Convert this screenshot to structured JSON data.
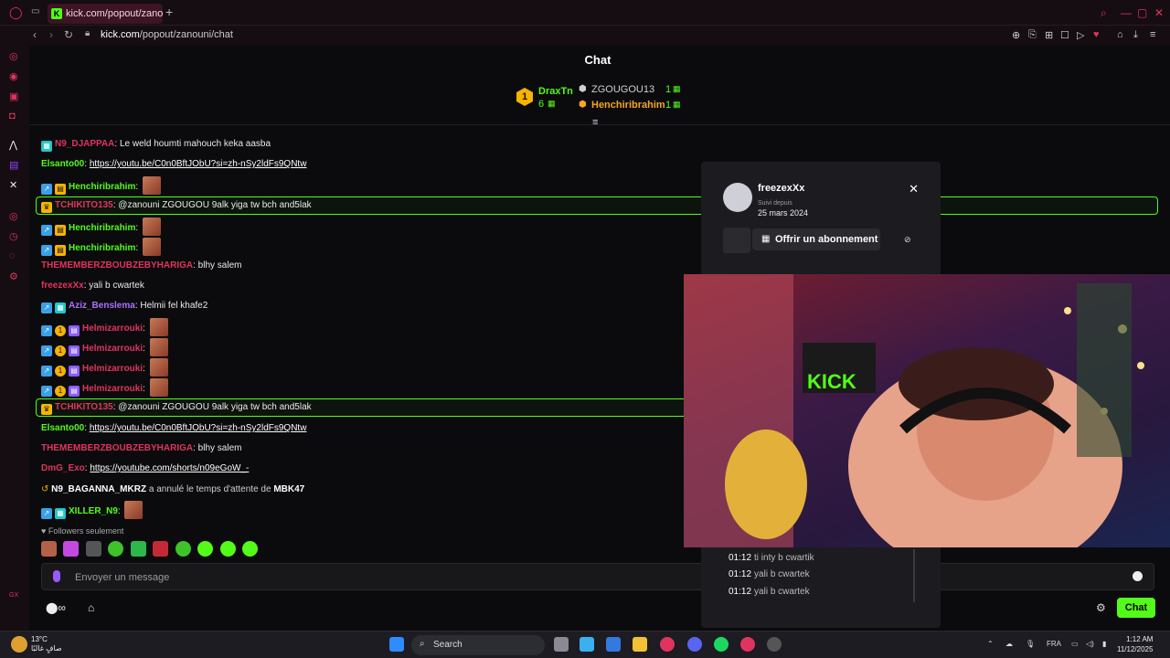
{
  "browser": {
    "tab_title": "kick.com/popout/zanouni",
    "new_tab": "+",
    "url_host": "kick.com",
    "url_path": "/popout/zanouni/chat"
  },
  "chat": {
    "title": "Chat",
    "leaderboard": [
      {
        "name": "DraxTn",
        "count": "6",
        "rank": "1",
        "color": "#53fc18"
      },
      {
        "name": "ZGOUGOU13",
        "count": "1",
        "color": "#cfcfcf"
      },
      {
        "name": "Henchiribrahim",
        "count": "1",
        "color": "#f5a623"
      }
    ],
    "messages": [
      {
        "user": "N9_DJAPPAA",
        "user_color": "#e0345f",
        "text": ": Le weld houmti mahouch keka aasba"
      },
      {
        "user": "Elsanto00",
        "user_color": "#53fc18",
        "text": ": ",
        "link": "https://youtu.be/C0n0BftJObU?si=zh-nSy2ldFs9QNtw"
      },
      {
        "user": "Henchiribrahim",
        "user_color": "#53fc18",
        "text": ": "
      },
      {
        "user": "TCHIKITO135",
        "user_color": "#e0345f",
        "text": ": @zanouni ZGOUGOU 9alk yiga tw bch and5lak"
      },
      {
        "user": "Henchiribrahim",
        "user_color": "#53fc18",
        "text": ": "
      },
      {
        "user": "Henchiribrahim",
        "user_color": "#53fc18",
        "text": ": "
      },
      {
        "user": "THEMEMBERZBOUBZEBYHARIGA",
        "user_color": "#e0345f",
        "text": ": blhy salem"
      },
      {
        "user": "freezexXx",
        "user_color": "#e0345f",
        "text": ": yali b cwartek"
      },
      {
        "user": "Aziz_Benslema",
        "user_color": "#a970ff",
        "text": ": Helmii fel khafe2"
      },
      {
        "user": "Helmizarrouki",
        "user_color": "#e0345f",
        "text": ": "
      },
      {
        "user": "Helmizarrouki",
        "user_color": "#e0345f",
        "text": ": "
      },
      {
        "user": "Helmizarrouki",
        "user_color": "#e0345f",
        "text": ": "
      },
      {
        "user": "Helmizarrouki",
        "user_color": "#e0345f",
        "text": ": "
      },
      {
        "user": "TCHIKITO135",
        "user_color": "#e0345f",
        "text": ": @zanouni ZGOUGOU 9alk yiga tw bch and5lak"
      },
      {
        "user": "Elsanto00",
        "user_color": "#53fc18",
        "text": ": ",
        "link": "https://youtu.be/C0n0BftJObU?si=zh-nSy2ldFs9QNtw"
      },
      {
        "user": "THEMEMBERZBOUBZEBYHARIGA",
        "user_color": "#e0345f",
        "text": ": blhy salem"
      },
      {
        "user": "DmG_Exo",
        "user_color": "#e0345f",
        "text": ": ",
        "link": "https://youtube.com/shorts/n09eGoW_-"
      }
    ],
    "system_message": {
      "user": "N9_BAGANNA_MKRZ",
      "text": " a annulé le temps d'attente de ",
      "target": "MBK47"
    },
    "last_message": {
      "user": "XILLER_N9",
      "user_color": "#53fc18",
      "text": ": "
    },
    "followers_only": "Followers seulement",
    "input_placeholder": "Envoyer un message",
    "send_label": "Chat"
  },
  "user_card": {
    "username": "freezexXx",
    "followed_since_label": "Suivi depuis",
    "followed_since": "25 mars 2024",
    "gift_label": "Offrir un abonnement",
    "close": "✕",
    "history": [
      {
        "time": "01:12",
        "text": "ti inty b cwartik"
      },
      {
        "time": "01:12",
        "text": "yali b cwartek"
      },
      {
        "time": "01:12",
        "text": "yali b cwartek"
      }
    ]
  },
  "video": {
    "sign_text": "KICK"
  },
  "taskbar": {
    "weather_temp": "13°C",
    "weather_desc": "صافٍ غالبًا",
    "search": "Search",
    "lang": "FRA",
    "time": "1:12 AM",
    "date": "11/12/2025"
  }
}
